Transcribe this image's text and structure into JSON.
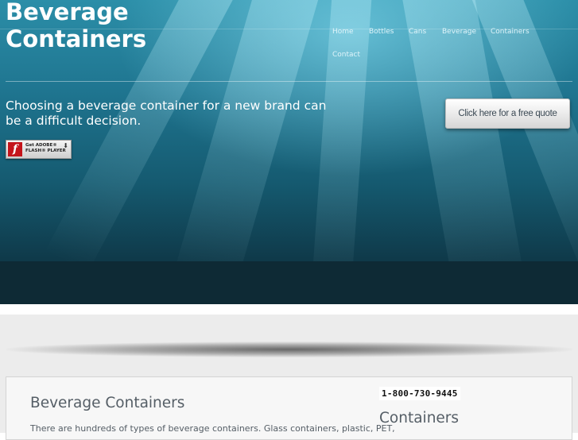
{
  "site": {
    "title": "Beverage Containers"
  },
  "nav": {
    "items": [
      {
        "label": "Home"
      },
      {
        "label": "Bottles"
      },
      {
        "label": "Cans"
      },
      {
        "label": "Beverage"
      },
      {
        "label": "Containers"
      },
      {
        "label": "Contact"
      }
    ]
  },
  "hero": {
    "tagline": "Choosing a beverage container for a new brand can be a difficult decision.",
    "quote_button": "Click here for a free quote",
    "flash_badge": {
      "line1": "Get ADOBE®",
      "line2": "FLASH® PLAYER",
      "logo": "f"
    }
  },
  "main": {
    "heading": "Beverage Containers",
    "text": "There are hundreds of types of beverage containers. Glass containers, plastic, PET,"
  },
  "sidebar": {
    "phone": "1-800-730-9445",
    "heading": "Containers"
  },
  "colors": {
    "hero_top": "#2b8ea8",
    "hero_bottom": "#0e2a35",
    "content_text": "#555e66",
    "page_grey": "#ececec"
  }
}
